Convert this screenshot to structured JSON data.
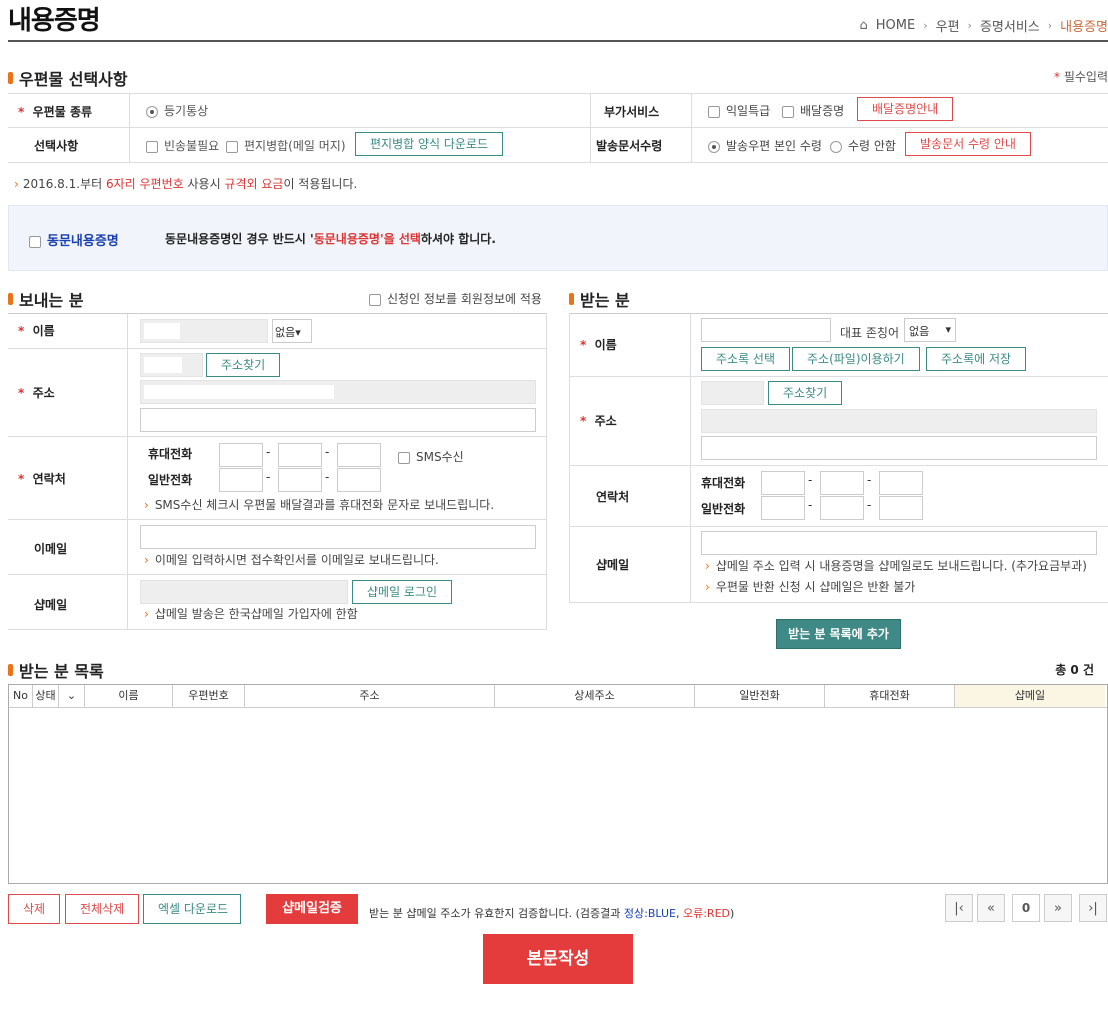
{
  "page": {
    "title": "내용증명"
  },
  "breadcrumb": {
    "home": "HOME",
    "items": [
      "우편",
      "증명서비스",
      "내용증명"
    ]
  },
  "options": {
    "title": "우편물 선택사항",
    "required_note": "필수입력",
    "mail_type_label": "우편물 종류",
    "mail_type_value": "등기통상",
    "select_label": "선택사항",
    "opt1": "빈송불필요",
    "opt2": "편지병합(메일 머지)",
    "merge_btn": "편지병합 양식 다운로드",
    "extra_label": "부가서비스",
    "extra1": "익일특급",
    "extra2": "배달증명",
    "extra_btn": "배달증명안내",
    "receipt_label": "발송문서수령",
    "receipt1": "발송우편 본인 수령",
    "receipt2": "수령 안함",
    "receipt_btn": "발송문서 수령 안내"
  },
  "notice": {
    "prefix": "2016.8.1.부터 ",
    "hl1": "6자리 우편번호",
    "mid": " 사용시 ",
    "hl2": "규격외 요금",
    "suffix": "이 적용됩니다."
  },
  "joint": {
    "label": "동문내용증명",
    "text1": "동문내용증명인 경우 반드시 '",
    "hl": "동문내용증명'을 선택",
    "text2": "하셔야 합니다."
  },
  "sender": {
    "title": "보내는 분",
    "apply_label": "신청인 정보를 회원정보에 적용",
    "name_label": "이름",
    "honor_value": "없음",
    "addr_label": "주소",
    "addr_btn": "주소찾기",
    "contact_label": "연락처",
    "mobile_label": "휴대전화",
    "phone_label": "일반전화",
    "sms_label": "SMS수신",
    "sms_hint": "SMS수신 체크시 우편물 배달결과를 휴대전화 문자로 보내드립니다.",
    "email_label": "이메일",
    "email_hint": "이메일 입력하시면 접수확인서를 이메일로 보내드립니다.",
    "shop_label": "샵메일",
    "shop_btn": "샵메일 로그인",
    "shop_hint": "샵메일 발송은 한국샵메일 가입자에 한함"
  },
  "receiver": {
    "title": "받는 분",
    "name_label": "이름",
    "honor_label": "대표 존칭어",
    "honor_value": "없음",
    "btn1": "주소록 선택",
    "btn2": "주소(파일)이용하기",
    "btn3": "주소록에 저장",
    "addr_label": "주소",
    "addr_btn": "주소찾기",
    "contact_label": "연락처",
    "mobile_label": "휴대전화",
    "phone_label": "일반전화",
    "shop_label": "샵메일",
    "shop_hint1": "샵메일 주소 입력 시 내용증명을 샵메일로도 보내드립니다. (추가요금부과)",
    "shop_hint2": "우편물 반환 신청 시 샵메일은 반환 불가",
    "add_btn": "받는 분 목록에 추가"
  },
  "list": {
    "title": "받는 분 목록",
    "total": "총 0 건",
    "columns": [
      "No",
      "상태",
      "",
      "이름",
      "우편번호",
      "주소",
      "상세주소",
      "일반전화",
      "휴대전화",
      "샵메일"
    ]
  },
  "actions": {
    "delete": "삭제",
    "delete_all": "전체삭제",
    "excel": "엑셀 다운로드",
    "verify": "샵메일검증",
    "verify_text1": "받는 분 샵메일 주소가 유효한지 검증합니다. (검증결과 ",
    "verify_ok": "정상:BLUE",
    "verify_sep": ", ",
    "verify_err": "오류:RED",
    "verify_text2": ")",
    "page_num": "0",
    "write": "본문작성"
  }
}
